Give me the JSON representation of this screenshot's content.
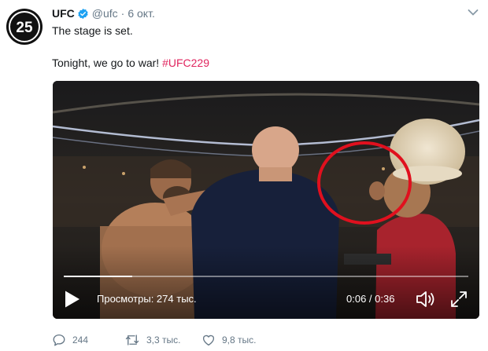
{
  "tweet": {
    "name": "UFC",
    "handle": "@ufc",
    "separator": "·",
    "time": "6 окт.",
    "line1": "The stage is set.",
    "line2_text": "Tonight, we go to war! ",
    "hashtag": "#UFC229",
    "avatar_text": "25"
  },
  "video": {
    "views": "Просмотры: 274 тыс.",
    "timecode": "0:06 / 0:36",
    "progress": 0.17
  },
  "actions": {
    "replies": "244",
    "retweets": "3,3 тыс.",
    "likes": "9,8 тыс."
  },
  "colors": {
    "hashtag": "#e0245e",
    "verified": "#1da1f2",
    "muted": "#657786",
    "highlight_circle": "#e0101e"
  }
}
